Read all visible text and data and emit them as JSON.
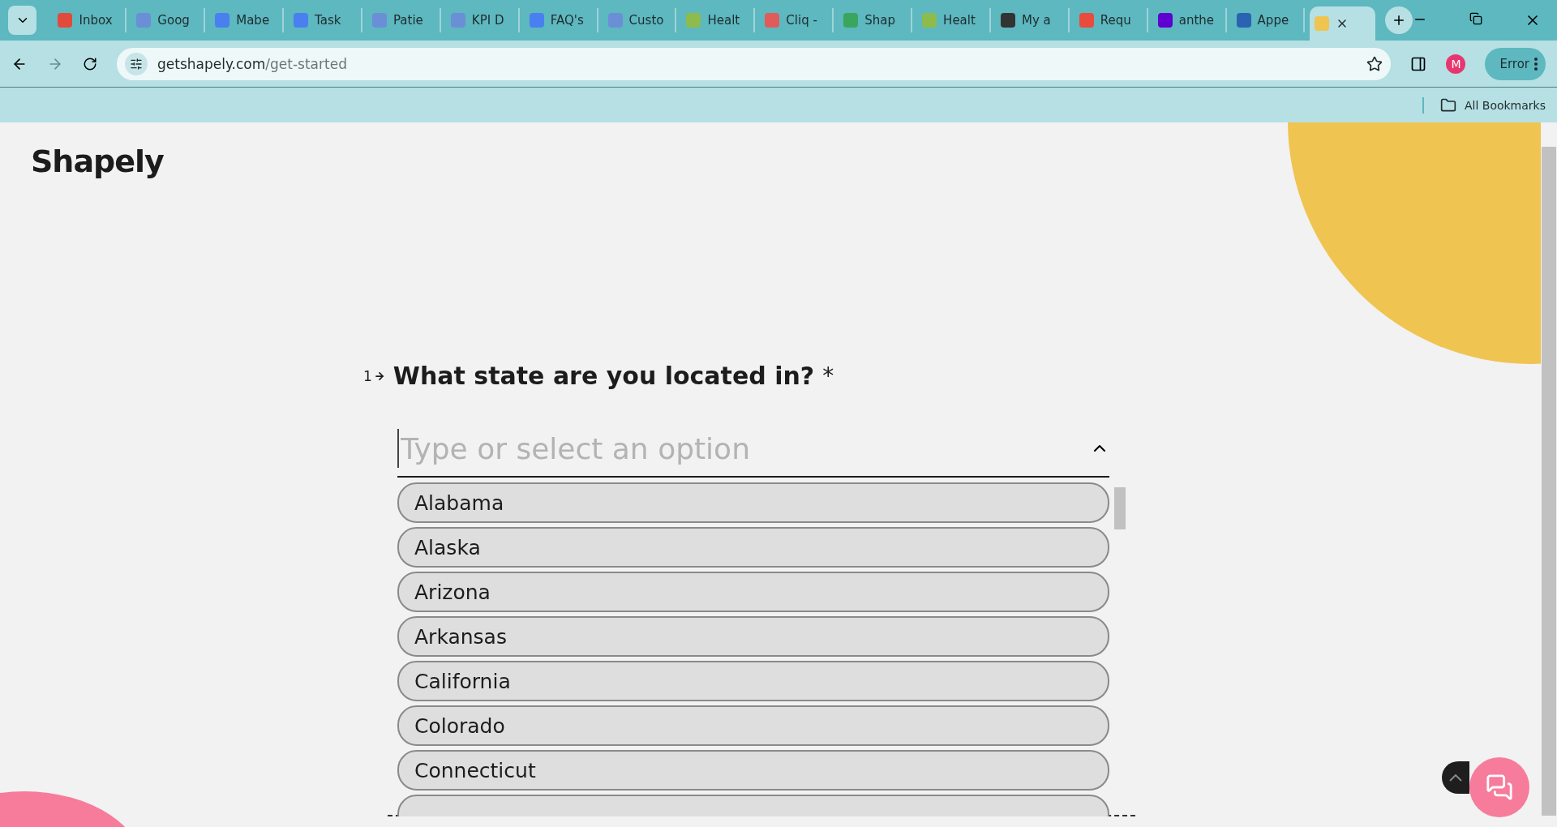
{
  "browser": {
    "tabs": [
      {
        "title": "Inbox",
        "selected": false
      },
      {
        "title": "Goog",
        "selected": false
      },
      {
        "title": "Mabe",
        "selected": false
      },
      {
        "title": "Task",
        "selected": false
      },
      {
        "title": "Patie",
        "selected": false
      },
      {
        "title": "KPI D",
        "selected": false
      },
      {
        "title": "FAQ's",
        "selected": false
      },
      {
        "title": "Custo",
        "selected": false
      },
      {
        "title": "Healt",
        "selected": false
      },
      {
        "title": "Cliq -",
        "selected": false
      },
      {
        "title": "Shap",
        "selected": false
      },
      {
        "title": "Healt",
        "selected": false
      },
      {
        "title": "My a",
        "selected": false
      },
      {
        "title": "Requ",
        "selected": false
      },
      {
        "title": "anthe",
        "selected": false
      },
      {
        "title": "Appe",
        "selected": false
      },
      {
        "selected": true
      }
    ],
    "url_host": "getshapely.com",
    "url_path": "/get-started",
    "profile_initial": "M",
    "error_label": "Error",
    "bookmarks_label": "All Bookmarks"
  },
  "page": {
    "logo": "Shapely",
    "question_number": "1",
    "question": "What state are you located in?",
    "required_mark": "*",
    "dropdown": {
      "placeholder": "Type or select an option",
      "expanded": true,
      "options": [
        "Alabama",
        "Alaska",
        "Arizona",
        "Arkansas",
        "California",
        "Colorado",
        "Connecticut"
      ]
    }
  }
}
